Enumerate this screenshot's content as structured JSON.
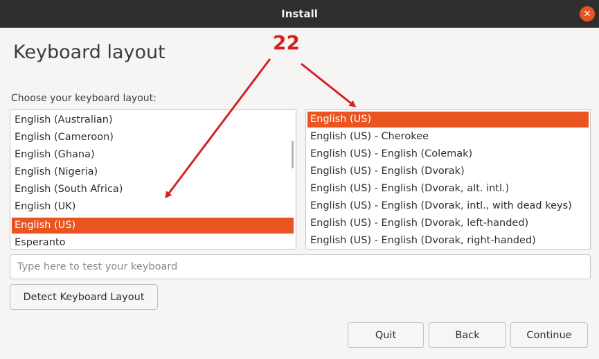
{
  "window": {
    "title": "Install",
    "close_glyph": "✕"
  },
  "page": {
    "title": "Keyboard layout",
    "prompt": "Choose your keyboard layout:"
  },
  "layouts": {
    "items": [
      {
        "label": "English (Australian)"
      },
      {
        "label": "English (Cameroon)"
      },
      {
        "label": "English (Ghana)"
      },
      {
        "label": "English (Nigeria)"
      },
      {
        "label": "English (South Africa)"
      },
      {
        "label": "English (UK)"
      },
      {
        "label": "English (US)"
      },
      {
        "label": "Esperanto"
      }
    ],
    "selected": "English (US)"
  },
  "variants": {
    "items": [
      {
        "label": "English (US)"
      },
      {
        "label": "English (US) - Cherokee"
      },
      {
        "label": "English (US) - English (Colemak)"
      },
      {
        "label": "English (US) - English (Dvorak)"
      },
      {
        "label": "English (US) - English (Dvorak, alt. intl.)"
      },
      {
        "label": "English (US) - English (Dvorak, intl., with dead keys)"
      },
      {
        "label": "English (US) - English (Dvorak, left-handed)"
      },
      {
        "label": "English (US) - English (Dvorak, right-handed)"
      }
    ],
    "selected": "English (US)"
  },
  "test_input": {
    "placeholder": "Type here to test your keyboard",
    "value": ""
  },
  "buttons": {
    "detect": "Detect Keyboard Layout",
    "quit": "Quit",
    "back": "Back",
    "continue": "Continue"
  },
  "annotation": {
    "step_number": "22",
    "color": "#d42020"
  },
  "colors": {
    "accent": "#e95420",
    "titlebar": "#2f2f2f"
  }
}
